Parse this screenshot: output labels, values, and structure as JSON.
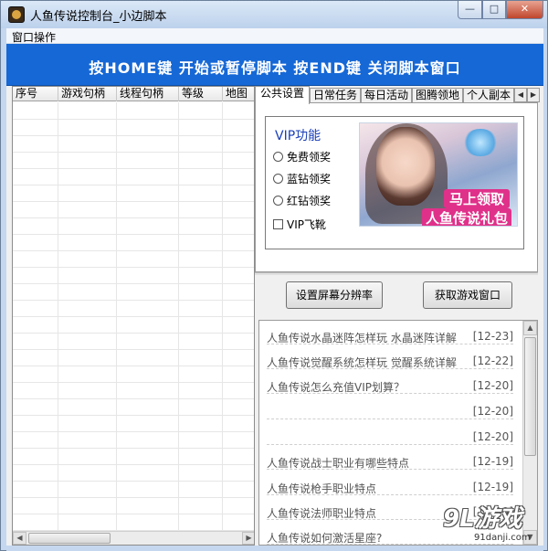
{
  "window": {
    "title": "人鱼传说控制台_小边脚本",
    "min_label": "—",
    "max_label": "□",
    "close_label": "✕"
  },
  "menu": {
    "items": [
      {
        "label": "窗口操作"
      }
    ]
  },
  "banner": {
    "text": "按HOME键 开始或暂停脚本   按END键 关闭脚本窗口"
  },
  "grid": {
    "columns": [
      "序号",
      "游戏句柄",
      "线程句柄",
      "等级",
      "地图"
    ],
    "scroll_left": "◀",
    "scroll_right": "▶"
  },
  "tabs": {
    "items": [
      "公共设置",
      "日常任务",
      "每日活动",
      "图腾领地",
      "个人副本"
    ],
    "active_index": 0,
    "scroll_left": "◀",
    "scroll_right": "▶"
  },
  "vip": {
    "title": "VIP功能",
    "options": [
      "免费领奖",
      "蓝钻领奖",
      "红钻领奖"
    ],
    "checkbox_label": "VIP飞靴",
    "ad_line1": "马上领取",
    "ad_line2": "人鱼传说礼包"
  },
  "buttons": {
    "resolution": "设置屏幕分辨率",
    "get_window": "获取游戏窗口"
  },
  "news": {
    "items": [
      {
        "title": "人鱼传说水晶迷阵怎样玩 水晶迷阵详解",
        "date": "[12-23]"
      },
      {
        "title": "人鱼传说觉醒系统怎样玩 觉醒系统详解",
        "date": "[12-22]"
      },
      {
        "title": "人鱼传说怎么充值VIP划算？",
        "date": "[12-20]"
      },
      {
        "title": "",
        "date": "[12-20]"
      },
      {
        "title": "",
        "date": "[12-20]"
      },
      {
        "title": "人鱼传说战士职业有哪些特点",
        "date": "[12-19]"
      },
      {
        "title": "人鱼传说枪手职业特点",
        "date": "[12-19]"
      },
      {
        "title": "人鱼传说法师职业特点",
        "date": "[12-19]"
      },
      {
        "title": "人鱼传说如何激活星座?",
        "date": ""
      }
    ],
    "scroll_up": "▲",
    "scroll_down": "▼"
  },
  "watermark": {
    "logo": "9L游戏",
    "url": "91danji.com"
  },
  "colors": {
    "banner": "#1668d6",
    "vip_title": "#1a3fb8",
    "ad_accent": "#e0318a"
  }
}
